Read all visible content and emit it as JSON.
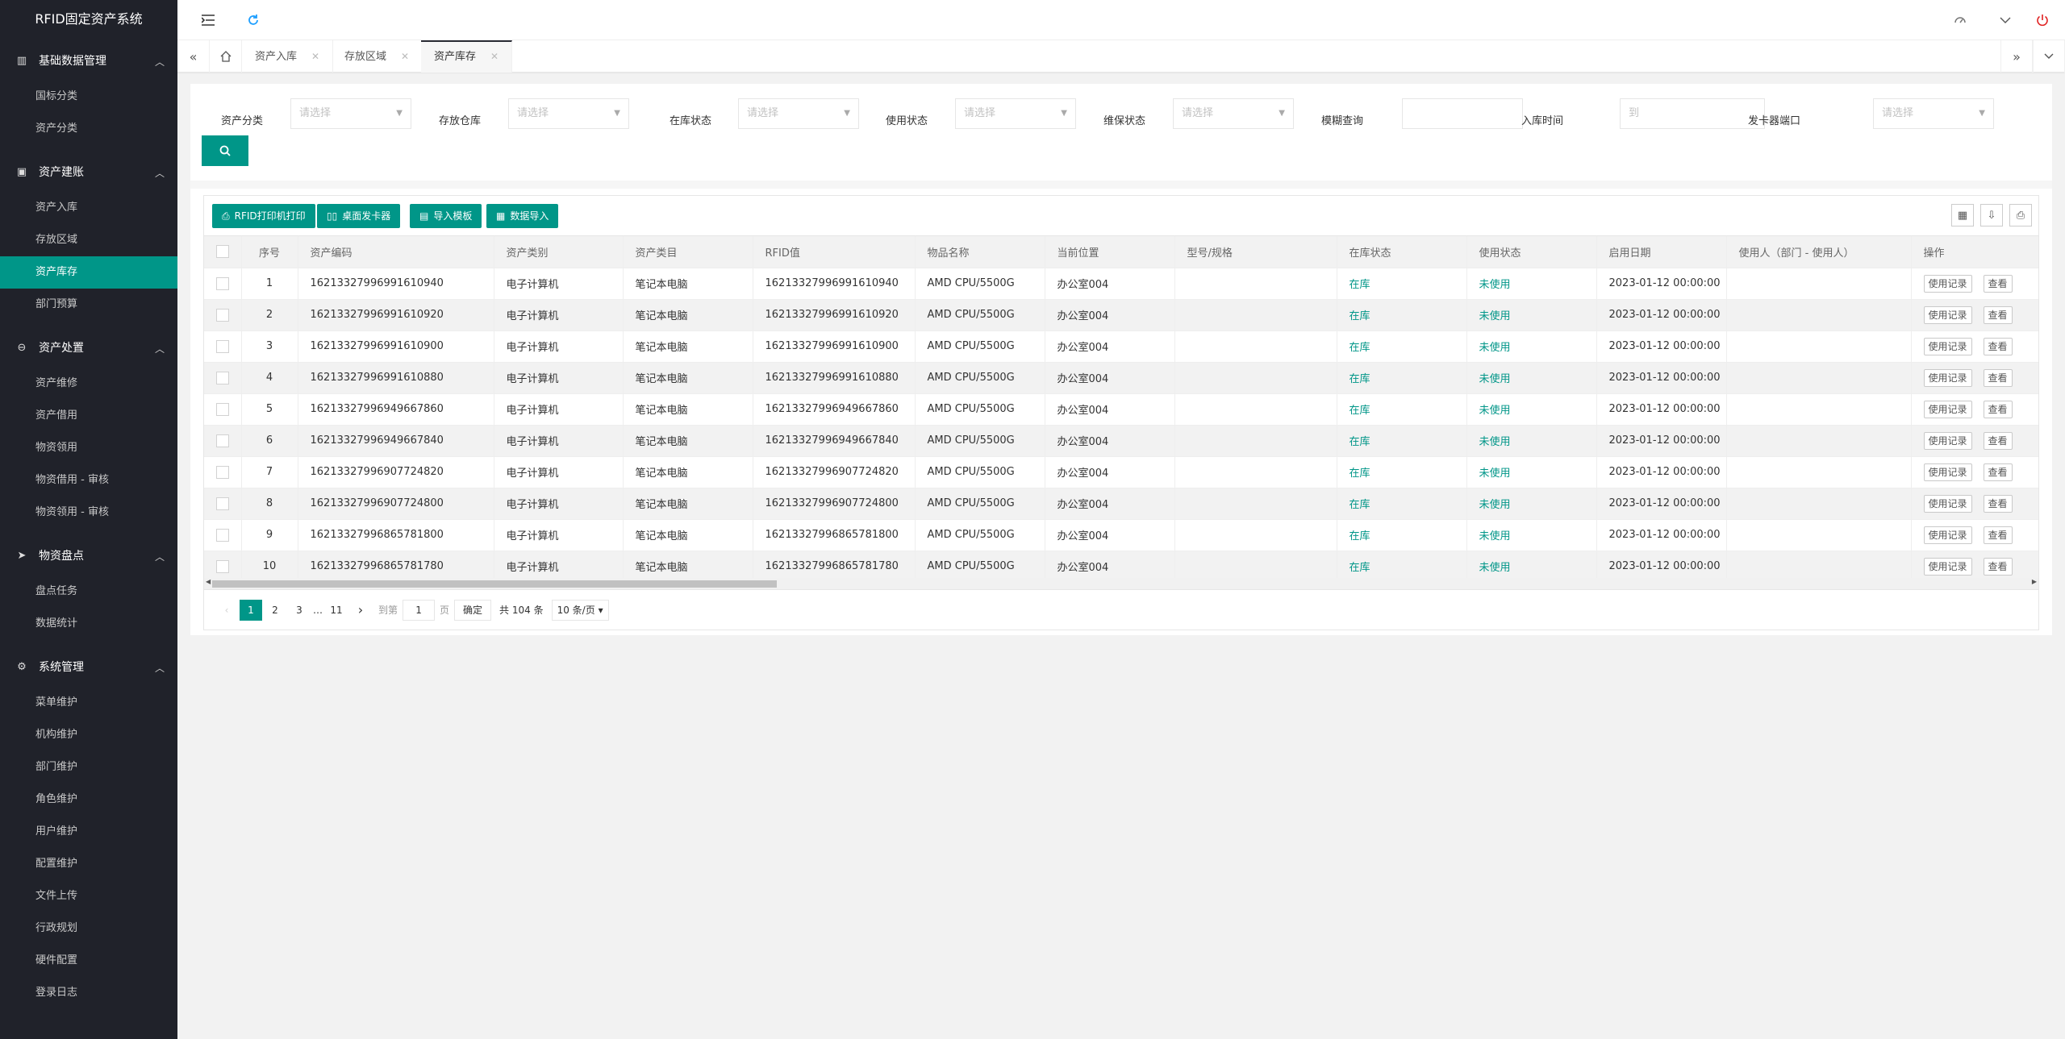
{
  "app": {
    "title": "RFID固定资产系统"
  },
  "sidebar": {
    "groups": [
      {
        "title": "基础数据管理",
        "items": [
          "国标分类",
          "资产分类"
        ]
      },
      {
        "title": "资产建账",
        "items": [
          "资产入库",
          "存放区域",
          "资产库存",
          "部门预算"
        ]
      },
      {
        "title": "资产处置",
        "items": [
          "资产维修",
          "资产借用",
          "物资领用",
          "物资借用 - 审核",
          "物资领用 - 审核"
        ]
      },
      {
        "title": "物资盘点",
        "items": [
          "盘点任务",
          "数据统计"
        ]
      },
      {
        "title": "系统管理",
        "items": [
          "菜单维护",
          "机构维护",
          "部门维护",
          "角色维护",
          "用户维护",
          "配置维护",
          "文件上传",
          "行政规划",
          "硬件配置",
          "登录日志"
        ]
      }
    ],
    "active_item": "资产库存"
  },
  "tabs": [
    {
      "label": "资产入库"
    },
    {
      "label": "存放区域"
    },
    {
      "label": "资产库存"
    }
  ],
  "filters": {
    "asset_category": {
      "label": "资产分类",
      "placeholder": "请选择"
    },
    "warehouse": {
      "label": "存放仓库",
      "placeholder": "请选择"
    },
    "stock_status": {
      "label": "在库状态",
      "placeholder": "请选择"
    },
    "use_status": {
      "label": "使用状态",
      "placeholder": "请选择"
    },
    "warranty_status": {
      "label": "维保状态",
      "placeholder": "请选择"
    },
    "fuzzy_search": {
      "label": "模糊查询",
      "placeholder": ""
    },
    "stock_time": {
      "label": "入库时间",
      "placeholder": "到"
    },
    "card_port": {
      "label": "发卡器端口",
      "placeholder": "请选择"
    }
  },
  "toolbar": {
    "print_label": "RFID打印机打印",
    "reader_label": "桌面发卡器",
    "template_label": "导入模板",
    "import_label": "数据导入"
  },
  "table": {
    "headers": [
      "序号",
      "资产编码",
      "资产类别",
      "资产类目",
      "RFID值",
      "物品名称",
      "当前位置",
      "型号/规格",
      "在库状态",
      "使用状态",
      "启用日期",
      "使用人（部门 - 使用人）",
      "操作"
    ],
    "op_labels": {
      "records": "使用记录",
      "view": "查看"
    },
    "rows": [
      {
        "no": "1",
        "code": "16213327996991610940",
        "category": "电子计算机",
        "item_class": "笔记本电脑",
        "rfid": "16213327996991610940",
        "name": "AMD CPU/5500G",
        "location": "办公室004",
        "model": "",
        "stock": "在库",
        "use": "未使用",
        "date": "2023-01-12 00:00:00",
        "user": ""
      },
      {
        "no": "2",
        "code": "16213327996991610920",
        "category": "电子计算机",
        "item_class": "笔记本电脑",
        "rfid": "16213327996991610920",
        "name": "AMD CPU/5500G",
        "location": "办公室004",
        "model": "",
        "stock": "在库",
        "use": "未使用",
        "date": "2023-01-12 00:00:00",
        "user": ""
      },
      {
        "no": "3",
        "code": "16213327996991610900",
        "category": "电子计算机",
        "item_class": "笔记本电脑",
        "rfid": "16213327996991610900",
        "name": "AMD CPU/5500G",
        "location": "办公室004",
        "model": "",
        "stock": "在库",
        "use": "未使用",
        "date": "2023-01-12 00:00:00",
        "user": ""
      },
      {
        "no": "4",
        "code": "16213327996991610880",
        "category": "电子计算机",
        "item_class": "笔记本电脑",
        "rfid": "16213327996991610880",
        "name": "AMD CPU/5500G",
        "location": "办公室004",
        "model": "",
        "stock": "在库",
        "use": "未使用",
        "date": "2023-01-12 00:00:00",
        "user": ""
      },
      {
        "no": "5",
        "code": "16213327996949667860",
        "category": "电子计算机",
        "item_class": "笔记本电脑",
        "rfid": "16213327996949667860",
        "name": "AMD CPU/5500G",
        "location": "办公室004",
        "model": "",
        "stock": "在库",
        "use": "未使用",
        "date": "2023-01-12 00:00:00",
        "user": ""
      },
      {
        "no": "6",
        "code": "16213327996949667840",
        "category": "电子计算机",
        "item_class": "笔记本电脑",
        "rfid": "16213327996949667840",
        "name": "AMD CPU/5500G",
        "location": "办公室004",
        "model": "",
        "stock": "在库",
        "use": "未使用",
        "date": "2023-01-12 00:00:00",
        "user": ""
      },
      {
        "no": "7",
        "code": "16213327996907724820",
        "category": "电子计算机",
        "item_class": "笔记本电脑",
        "rfid": "16213327996907724820",
        "name": "AMD CPU/5500G",
        "location": "办公室004",
        "model": "",
        "stock": "在库",
        "use": "未使用",
        "date": "2023-01-12 00:00:00",
        "user": ""
      },
      {
        "no": "8",
        "code": "16213327996907724800",
        "category": "电子计算机",
        "item_class": "笔记本电脑",
        "rfid": "16213327996907724800",
        "name": "AMD CPU/5500G",
        "location": "办公室004",
        "model": "",
        "stock": "在库",
        "use": "未使用",
        "date": "2023-01-12 00:00:00",
        "user": ""
      },
      {
        "no": "9",
        "code": "16213327996865781800",
        "category": "电子计算机",
        "item_class": "笔记本电脑",
        "rfid": "16213327996865781800",
        "name": "AMD CPU/5500G",
        "location": "办公室004",
        "model": "",
        "stock": "在库",
        "use": "未使用",
        "date": "2023-01-12 00:00:00",
        "user": ""
      },
      {
        "no": "10",
        "code": "16213327996865781780",
        "category": "电子计算机",
        "item_class": "笔记本电脑",
        "rfid": "16213327996865781780",
        "name": "AMD CPU/5500G",
        "location": "办公室004",
        "model": "",
        "stock": "在库",
        "use": "未使用",
        "date": "2023-01-12 00:00:00",
        "user": ""
      }
    ]
  },
  "pagination": {
    "pages": [
      "1",
      "2",
      "3",
      "…",
      "11"
    ],
    "current": "1",
    "goto_prefix": "到第",
    "goto_value": "1",
    "goto_suffix": "页",
    "confirm": "确定",
    "total": "共 104 条",
    "page_size": "10 条/页"
  },
  "colors": {
    "accent": "#009688",
    "sidebar": "#20222a"
  }
}
